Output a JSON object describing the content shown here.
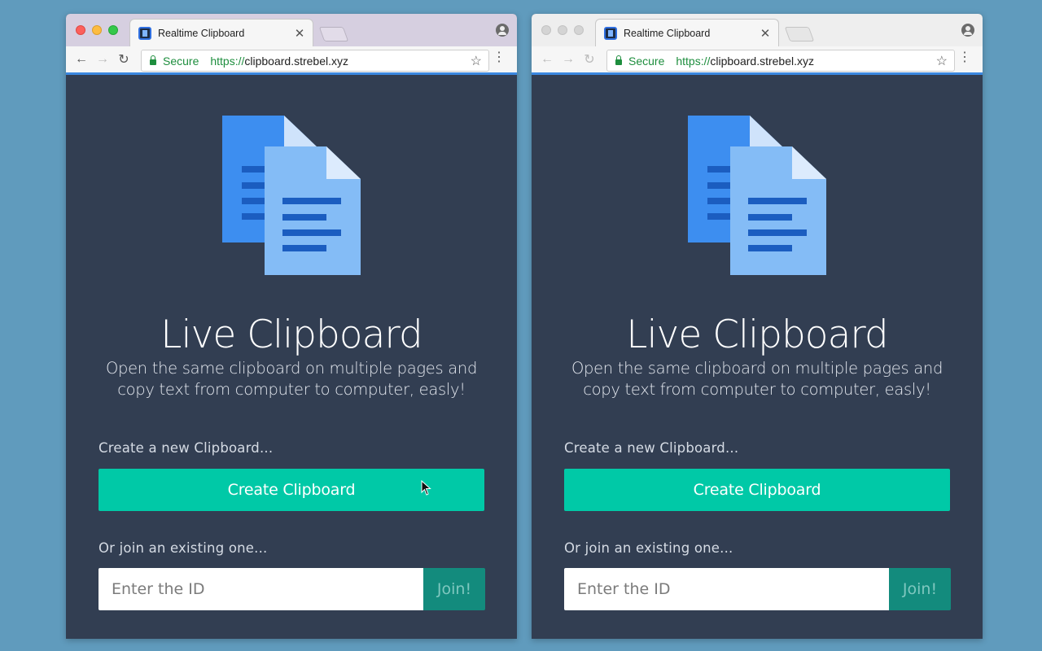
{
  "colors": {
    "background": "#609bbd",
    "page": "#323e52",
    "accent": "#00c9a7",
    "join": "#138b7d",
    "doc_back": "#3d8ef0",
    "doc_front": "#84bcf6",
    "doc_lines": "#1b5dc0"
  },
  "windows": [
    {
      "tab": {
        "title": "Realtime Clipboard",
        "close_icon": "close-icon"
      },
      "toolbar": {
        "secure_label": "Secure",
        "url_scheme": "https://",
        "url_host": "clipboard.strebel.xyz"
      },
      "page": {
        "heading": "Live Clipboard",
        "subtitle": "Open the same clipboard on multiple pages and copy text from computer to computer, easly!",
        "create_label": "Create a new Clipboard...",
        "create_button": "Create Clipboard",
        "join_label": "Or join an existing one...",
        "id_placeholder": "Enter the ID",
        "join_button": "Join!"
      }
    },
    {
      "tab": {
        "title": "Realtime Clipboard",
        "close_icon": "close-icon"
      },
      "toolbar": {
        "secure_label": "Secure",
        "url_scheme": "https://",
        "url_host": "clipboard.strebel.xyz"
      },
      "page": {
        "heading": "Live Clipboard",
        "subtitle": "Open the same clipboard on multiple pages and copy text from computer to computer, easly!",
        "create_label": "Create a new Clipboard...",
        "create_button": "Create Clipboard",
        "join_label": "Or join an existing one...",
        "id_placeholder": "Enter the ID",
        "join_button": "Join!"
      }
    }
  ]
}
